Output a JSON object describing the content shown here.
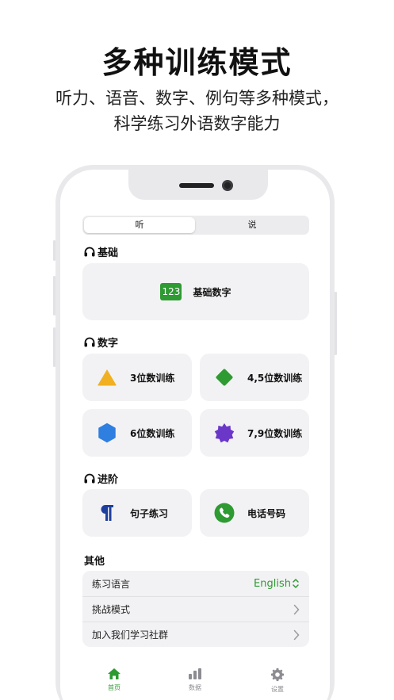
{
  "promo": {
    "headline": "多种训练模式",
    "subline": "听力、语音、数字、例句等多种模式，科学练习外语数字能力"
  },
  "segment": {
    "listen": "听",
    "speak": "说"
  },
  "sections": {
    "basic": "基础",
    "numbers": "数字",
    "advanced": "进阶",
    "other": "其他"
  },
  "basic_card": {
    "badge": "123",
    "label": "基础数字"
  },
  "number_cards": [
    {
      "label": "3位数训练",
      "icon": "triangle-icon",
      "color": "#f0b021"
    },
    {
      "label": "4,5位数训练",
      "icon": "diamond-icon",
      "color": "#2e9a32"
    },
    {
      "label": "6位数训练",
      "icon": "hexagon-icon",
      "color": "#2f7fe0"
    },
    {
      "label": "7,9位数训练",
      "icon": "star-burst-icon",
      "color": "#6b37c9"
    }
  ],
  "advanced_cards": [
    {
      "label": "句子练习",
      "icon": "pilcrow-icon",
      "color": "#1f3f9e"
    },
    {
      "label": "电话号码",
      "icon": "phone-icon",
      "color": "#2e9a32"
    }
  ],
  "other_list": {
    "language_label": "练习语言",
    "language_value": "English",
    "challenge_label": "挑战模式",
    "community_label": "加入我们学习社群"
  },
  "tabs": {
    "home": "首页",
    "data": "数据",
    "settings": "设置"
  },
  "colors": {
    "accent": "#2e9a32"
  }
}
